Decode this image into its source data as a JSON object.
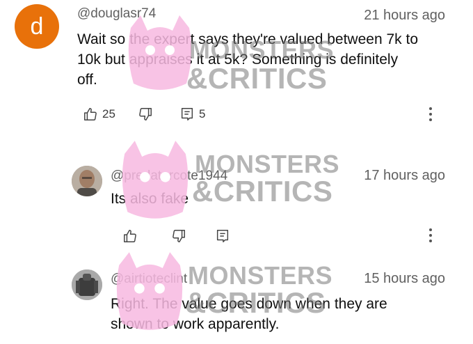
{
  "comments": [
    {
      "avatar_letter": "d",
      "username": "@douglasr74",
      "time": "21 hours ago",
      "lines": [
        "Wait so the expert says they're valued between 7k to",
        "10k but appraises it at 5k? Something is definitely",
        "off."
      ],
      "likes": "25",
      "replies": "5"
    },
    {
      "username": "@predatorcote1944",
      "time": "17 hours ago",
      "lines": [
        "Its also fake"
      ]
    },
    {
      "username": "@airtioteclint",
      "time": "15 hours ago",
      "lines": [
        "Right. The value goes down when they are",
        "shown to work apparently."
      ]
    }
  ],
  "icons": {
    "like": "thumbs-up-icon",
    "dislike": "thumbs-down-icon",
    "reply": "reply-comment-icon",
    "more": "more-vert-icon"
  },
  "watermark": {
    "line1": "MONSTERS",
    "line2": "&CRITICS",
    "blob_color": "#f7b8e0"
  },
  "colors": {
    "avatar_bg": "#e8710a",
    "secondary_text": "#606060"
  }
}
